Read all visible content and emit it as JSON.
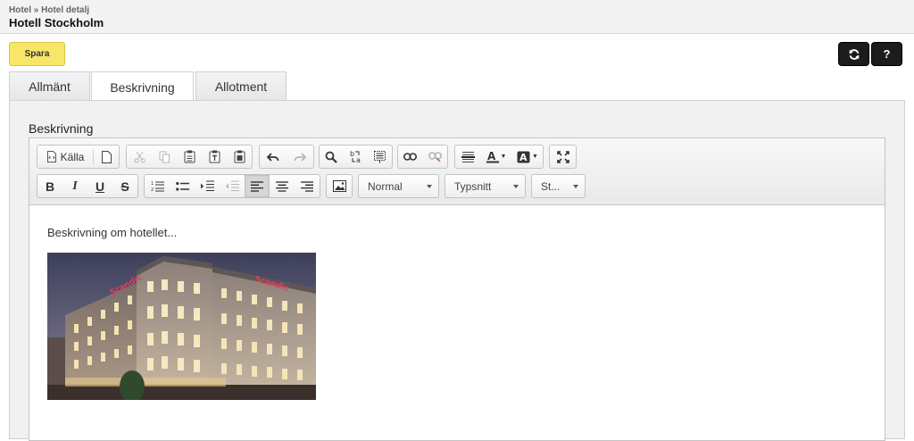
{
  "header": {
    "breadcrumb": "Hotel » Hotel detalj",
    "title": "Hotell Stockholm"
  },
  "actions": {
    "save_label": "Spara",
    "help_label": "?"
  },
  "tabs": [
    {
      "label": "Allmänt",
      "active": false
    },
    {
      "label": "Beskrivning",
      "active": true
    },
    {
      "label": "Allotment",
      "active": false
    }
  ],
  "editor": {
    "field_label": "Beskrivning",
    "source_label": "Källa",
    "format_combo": "Normal",
    "font_combo": "Typsnitt",
    "size_combo": "St...",
    "bold": "B",
    "italic": "I",
    "underline": "U",
    "strike": "S",
    "body_text": "Beskrivning om hotellet...",
    "image_sign": "Scandic"
  },
  "colors": {
    "save_button": "#f7e668",
    "dark_button": "#1c1c1c",
    "sign_red": "#e0405e"
  }
}
